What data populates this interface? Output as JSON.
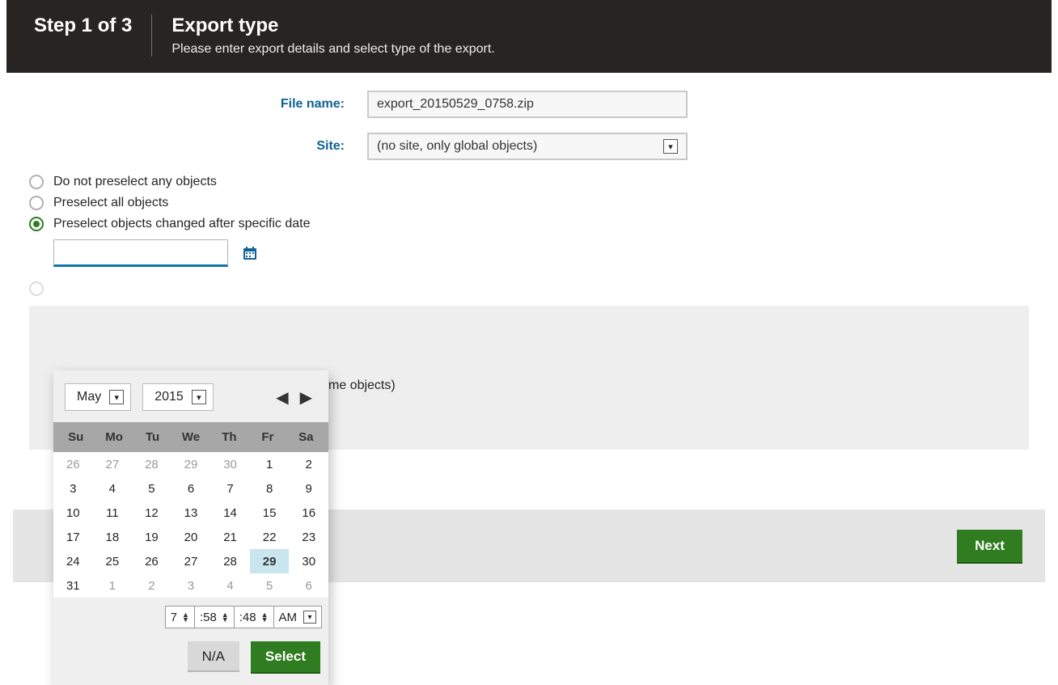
{
  "header": {
    "step": "Step 1 of 3",
    "title": "Export type",
    "subtitle": "Please enter export details and select type of the export."
  },
  "form": {
    "file_name_label": "File name:",
    "file_name_value": "export_20150529_0758.zip",
    "site_label": "Site:",
    "site_value": "(no site, only global objects)"
  },
  "radios": {
    "opt_none": "Do not preselect any objects",
    "opt_all": "Preselect all objects",
    "opt_date": "Preselect objects changed after specific date",
    "opt_hidden_tail": "me objects)"
  },
  "date_input": {
    "value": ""
  },
  "picker": {
    "month": "May",
    "year": "2015",
    "dow": [
      "Su",
      "Mo",
      "Tu",
      "We",
      "Th",
      "Fr",
      "Sa"
    ],
    "weeks": [
      [
        {
          "d": "26",
          "o": true
        },
        {
          "d": "27",
          "o": true
        },
        {
          "d": "28",
          "o": true
        },
        {
          "d": "29",
          "o": true
        },
        {
          "d": "30",
          "o": true
        },
        {
          "d": "1"
        },
        {
          "d": "2"
        }
      ],
      [
        {
          "d": "3"
        },
        {
          "d": "4"
        },
        {
          "d": "5"
        },
        {
          "d": "6"
        },
        {
          "d": "7"
        },
        {
          "d": "8"
        },
        {
          "d": "9"
        }
      ],
      [
        {
          "d": "10"
        },
        {
          "d": "11"
        },
        {
          "d": "12"
        },
        {
          "d": "13"
        },
        {
          "d": "14"
        },
        {
          "d": "15"
        },
        {
          "d": "16"
        }
      ],
      [
        {
          "d": "17"
        },
        {
          "d": "18"
        },
        {
          "d": "19"
        },
        {
          "d": "20"
        },
        {
          "d": "21"
        },
        {
          "d": "22"
        },
        {
          "d": "23"
        }
      ],
      [
        {
          "d": "24"
        },
        {
          "d": "25"
        },
        {
          "d": "26"
        },
        {
          "d": "27"
        },
        {
          "d": "28"
        },
        {
          "d": "29",
          "sel": true
        },
        {
          "d": "30"
        }
      ],
      [
        {
          "d": "31"
        },
        {
          "d": "1",
          "o": true
        },
        {
          "d": "2",
          "o": true
        },
        {
          "d": "3",
          "o": true
        },
        {
          "d": "4",
          "o": true
        },
        {
          "d": "5",
          "o": true
        },
        {
          "d": "6",
          "o": true
        }
      ]
    ],
    "time": {
      "h": "7",
      "m": ":58",
      "s": ":48",
      "ampm": "AM"
    },
    "na_label": "N/A",
    "select_label": "Select"
  },
  "footer": {
    "next_label": "Next"
  }
}
